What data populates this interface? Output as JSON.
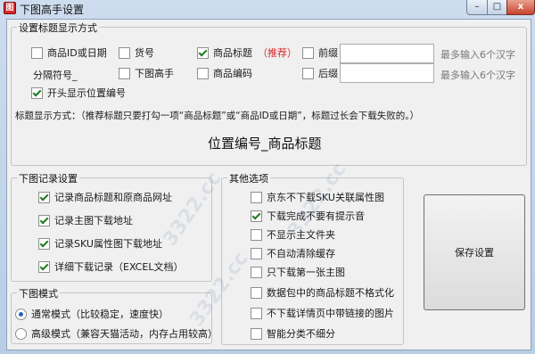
{
  "window": {
    "title": "下图高手设置",
    "min": "–",
    "max": "□",
    "close": "x"
  },
  "title_group": {
    "legend": "设置标题显示方式",
    "product_id": "商品ID或日期",
    "item_no": "货号",
    "product_title": "商品标题",
    "recommend": "（推荐）",
    "prefix": "前缀",
    "prefix_hint": "最多输入6个汉字",
    "separator": "分隔符号_",
    "download_master": "下图高手",
    "product_code": "商品编码",
    "suffix": "后缀",
    "suffix_hint": "最多输入6个汉字",
    "open_display": "开头显示位置编号",
    "desc": "标题显示方式：（推荐标题只要打勾一项“商品标题”或“商品ID或日期”，标题过长会下载失败的。）",
    "preview": "位置编号_商品标题"
  },
  "record_group": {
    "legend": "下图记录设置",
    "items": [
      "记录商品标题和原商品网址",
      "记录主图下载地址",
      "记录SKU属性图下载地址",
      "详细下载记录（EXCEL文档）"
    ]
  },
  "mode_group": {
    "legend": "下图模式",
    "normal": "通常模式（比较稳定，速度快）",
    "advanced": "高级模式（兼容天猫活动，内存占用较高）"
  },
  "other_group": {
    "legend": "其他选项",
    "items": [
      "京东不下载SKU关联属性图",
      "下载完成不要有提示音",
      "不显示主文件夹",
      "不自动清除缓存",
      "只下载第一张主图",
      "数据包中的商品标题不格式化",
      "不下载详情页中带链接的图片",
      "智能分类不细分"
    ]
  },
  "save_button": "保存设置",
  "watermark": "3322.cc"
}
